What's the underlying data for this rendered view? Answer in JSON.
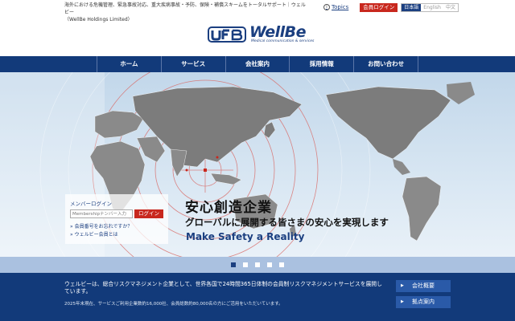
{
  "header": {
    "tagline_line1": "海外における危機管理、緊急事故対応、重大疾病事故・予防、保険・補償スキームをトータルサポート｜ウェルビー",
    "tagline_line2": "（WellBe Holdings Limited）",
    "topics_label": "Topics",
    "member_login_label": "会員ログイン",
    "languages": [
      "日本語",
      "English",
      "中文"
    ],
    "logo_name": "WellBe",
    "logo_sub": "Medical communication & services"
  },
  "nav": {
    "items": [
      "ホーム",
      "サービス",
      "会社案内",
      "採用情報",
      "お問い合わせ"
    ]
  },
  "hero": {
    "headline": "安心創造企業",
    "subheadline": "グローバルに展開する皆さまの安心を実現します",
    "english": "Make Safety a Reality",
    "slide_count": 5,
    "active_slide": 1
  },
  "login": {
    "title": "メンバーログイン",
    "placeholder": "Membershipナンバー入力",
    "button": "ログイン",
    "forgot_link": "会員番号をお忘れですか？",
    "about_link": "ウェルビー会員とは"
  },
  "band": {
    "text": "ウェルビーは、総合リスクマネジメント企業として、世界各国で24時間365日体制の会員制リスクマネジメントサービスを展開しています。",
    "note": "2025年末現在、サービスご利用企業数約16,000社、会員総数約80,000名の方にご活用をいただいています。",
    "btn_company": "会社概要",
    "btn_locations": "拠点案内"
  },
  "colors": {
    "navy": "#123a7a",
    "accent_red": "#c8281e",
    "hero_bg": "#cfe0ee"
  }
}
